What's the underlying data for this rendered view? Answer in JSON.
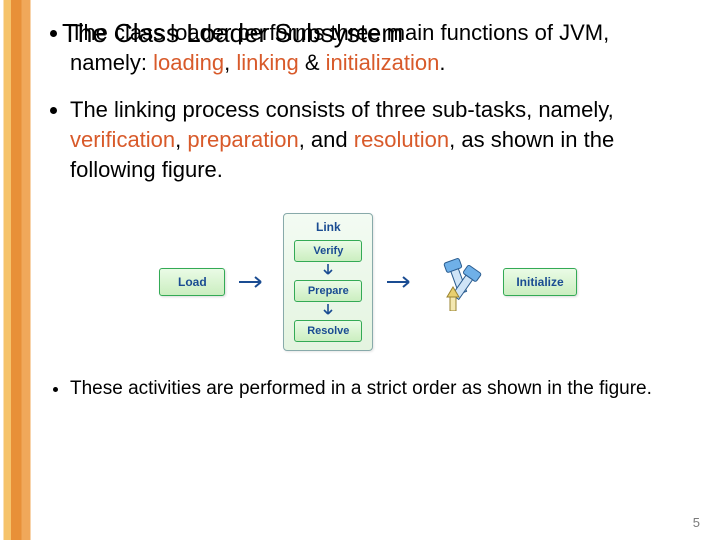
{
  "title": "The Class Loader Subsystem",
  "bullets": [
    {
      "parts": [
        {
          "t": "The class loader performs three main functions of JVM, namely: "
        },
        {
          "t": "loading",
          "hl": true
        },
        {
          "t": ", "
        },
        {
          "t": "linking",
          "hl": true
        },
        {
          "t": " & "
        },
        {
          "t": "initialization",
          "hl": true
        },
        {
          "t": "."
        }
      ],
      "small": false
    },
    {
      "parts": [
        {
          "t": "The linking process consists of three sub-tasks, namely, "
        },
        {
          "t": "verification",
          "hl": true
        },
        {
          "t": ", "
        },
        {
          "t": "preparation",
          "hl": true
        },
        {
          "t": ", and "
        },
        {
          "t": "resolution",
          "hl": true
        },
        {
          "t": ", as shown in the following figure."
        }
      ],
      "small": false
    }
  ],
  "bullet_after": {
    "parts": [
      {
        "t": "These activities are performed in a strict order as shown in the figure."
      }
    ],
    "small": true
  },
  "figure": {
    "load": "Load",
    "link": "Link",
    "verify": "Verify",
    "prepare": "Prepare",
    "resolve": "Resolve",
    "initialize": "Initialize"
  },
  "page_number": "5"
}
